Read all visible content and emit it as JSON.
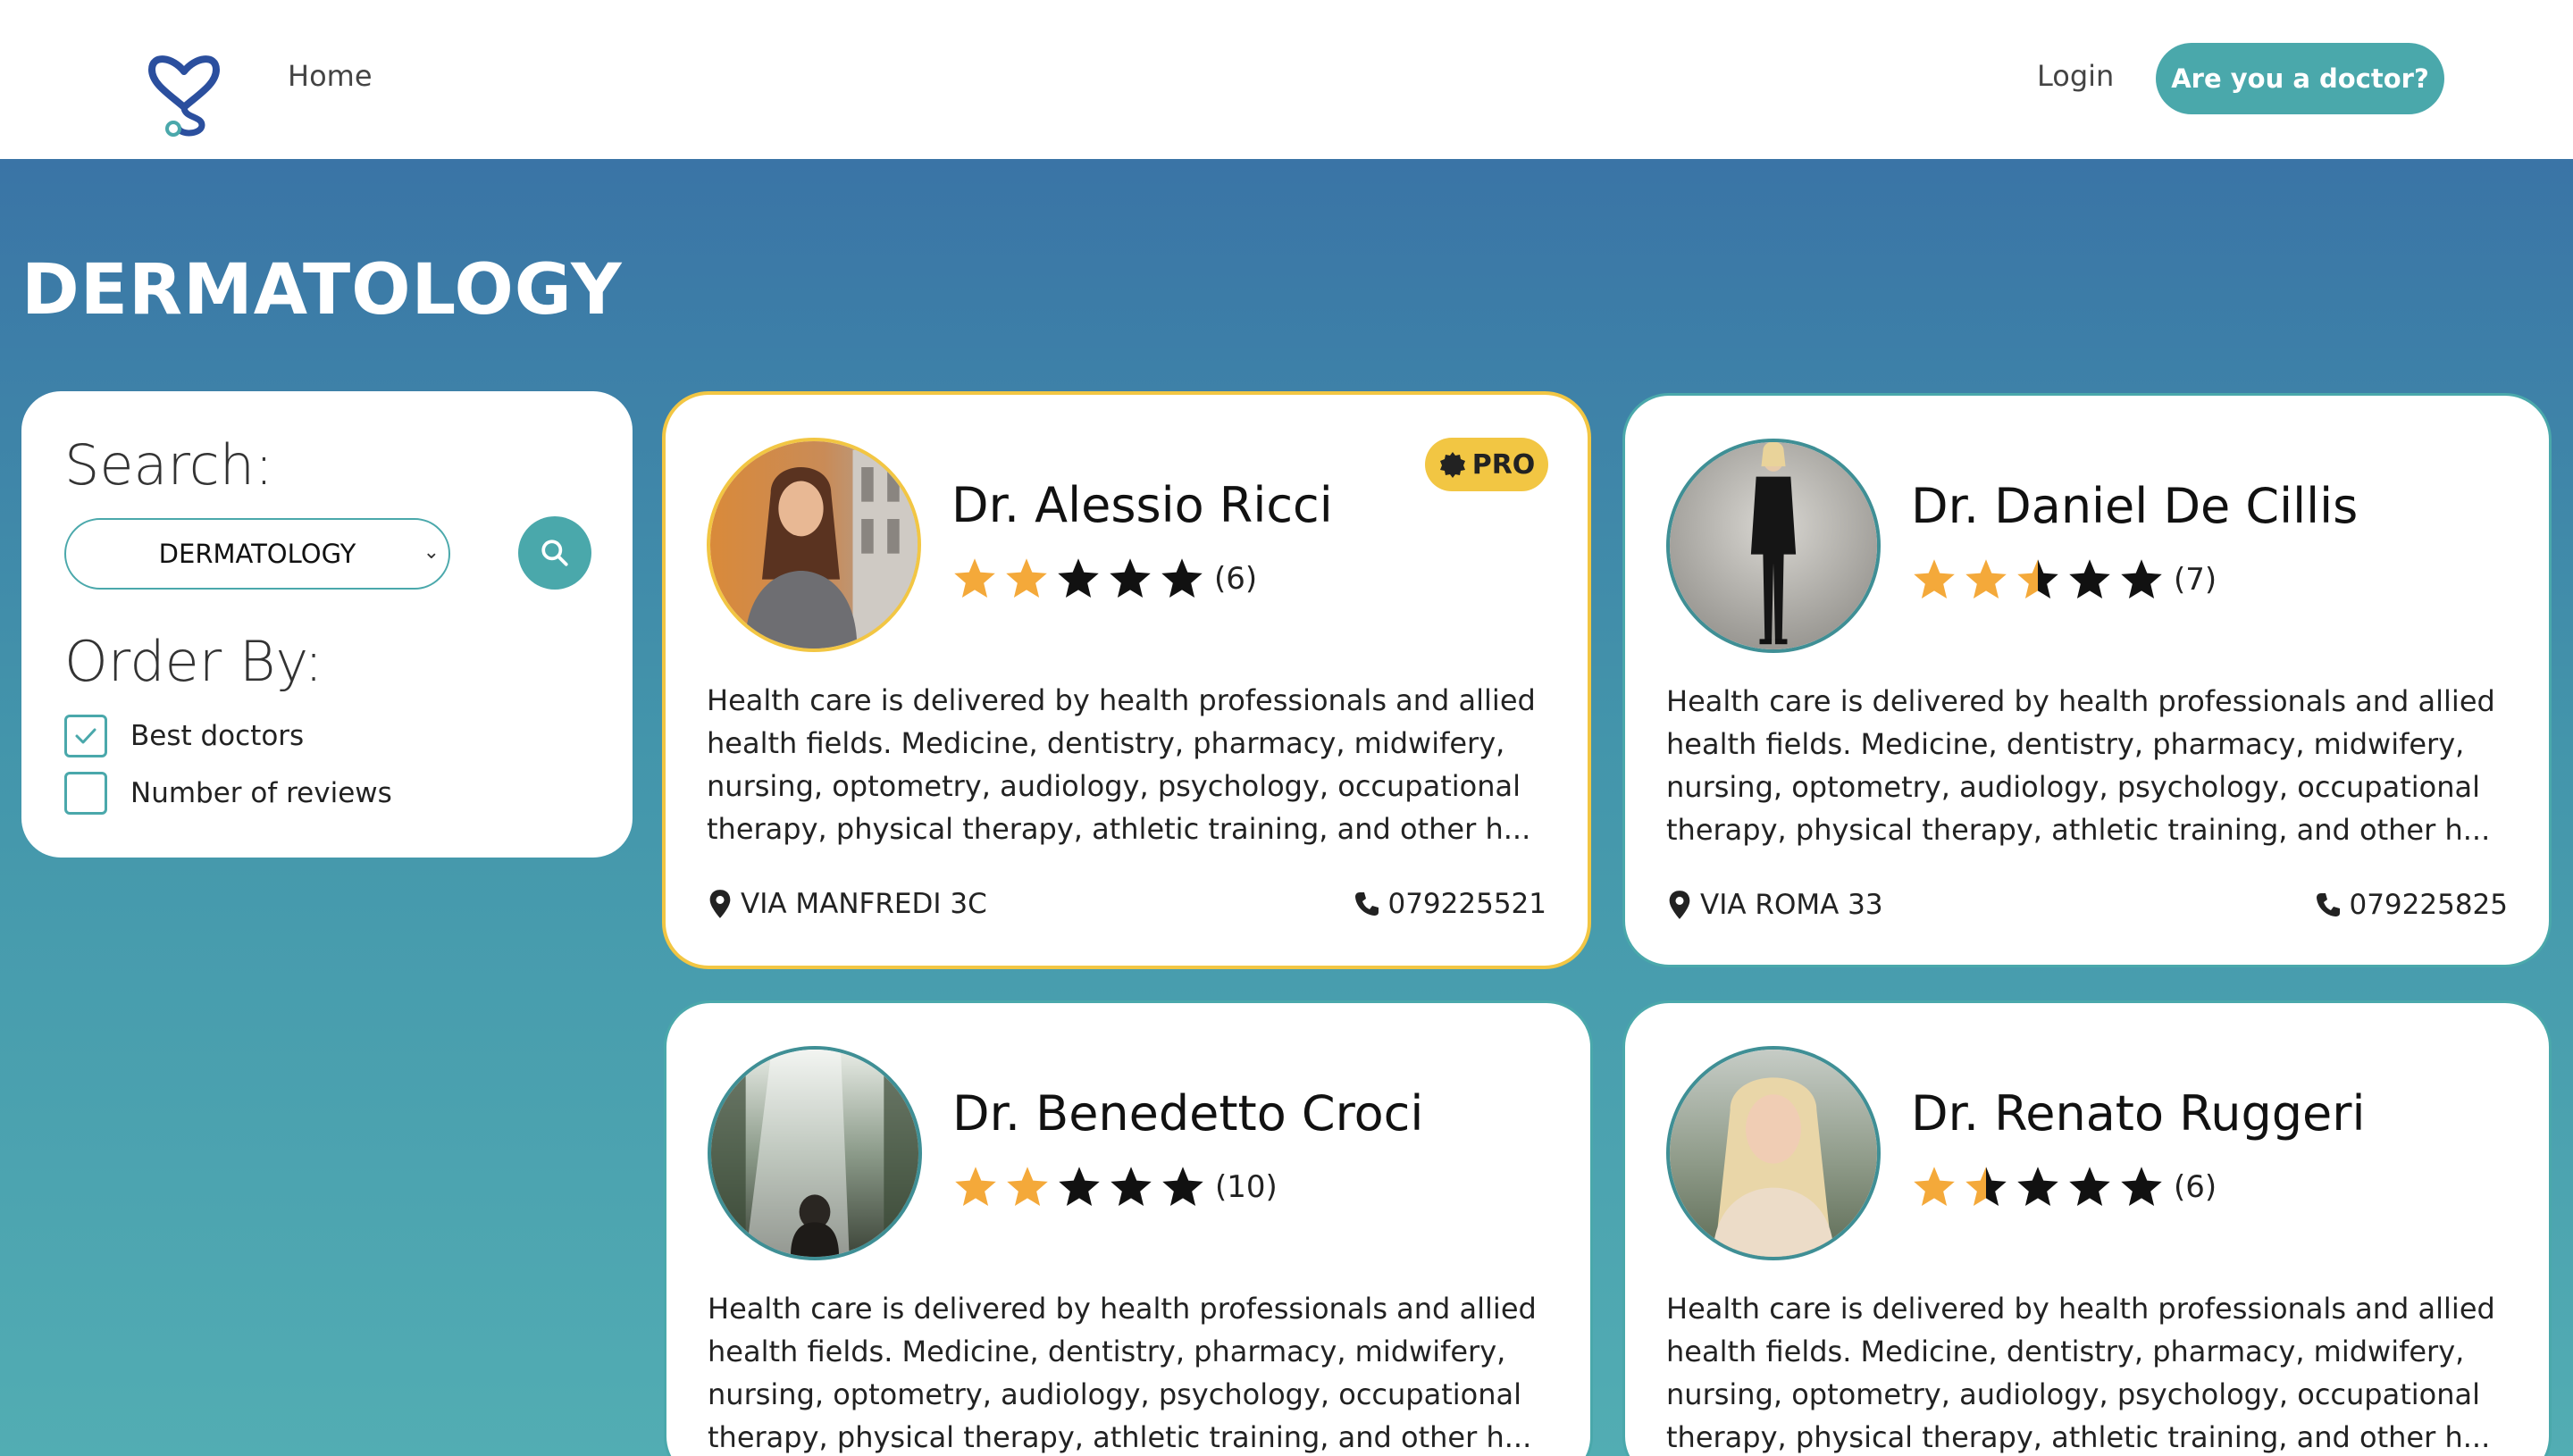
{
  "navbar": {
    "logo_icon": "stethoscope-heart-icon",
    "home_label": "Home",
    "login_label": "Login",
    "cta_label": "Are you a doctor?"
  },
  "page_title": "DERMATOLOGY",
  "filters": {
    "search_heading": "Search:",
    "specialty_selected": "DERMATOLOGY",
    "search_icon": "search-icon",
    "order_heading": "Order By:",
    "options": [
      {
        "label": "Best doctors",
        "checked": true
      },
      {
        "label": "Number of reviews",
        "checked": false
      }
    ]
  },
  "doctors": [
    {
      "name": "Dr. Alessio Ricci",
      "pro": true,
      "pro_label": "PRO",
      "rating": 2,
      "reviews": "(6)",
      "description": "Health care is delivered by health professionals and allied health fields. Medicine, dentistry, pharmacy, midwifery, nursing, optometry, audiology, psychology, occupational therapy, physical therapy, athletic training, and other h...",
      "address": "VIA MANFREDI 3C",
      "phone": "079225521"
    },
    {
      "name": "Dr. Daniel De Cillis",
      "pro": false,
      "rating": 2.5,
      "reviews": "(7)",
      "description": "Health care is delivered by health professionals and allied health fields. Medicine, dentistry, pharmacy, midwifery, nursing, optometry, audiology, psychology, occupational therapy, physical therapy, athletic training, and other h...",
      "address": "VIA ROMA 33",
      "phone": "079225825"
    },
    {
      "name": "Dr. Benedetto Croci",
      "pro": false,
      "rating": 2,
      "reviews": "(10)",
      "description": "Health care is delivered by health professionals and allied health fields. Medicine, dentistry, pharmacy, midwifery, nursing, optometry, audiology, psychology, occupational therapy, physical therapy, athletic training, and other h...",
      "address": "",
      "phone": ""
    },
    {
      "name": "Dr. Renato Ruggeri",
      "pro": false,
      "rating": 1.5,
      "reviews": "(6)",
      "description": "Health care is delivered by health professionals and allied health fields. Medicine, dentistry, pharmacy, midwifery, nursing, optometry, audiology, psychology, occupational therapy, physical therapy, athletic training, and other h...",
      "address": "",
      "phone": ""
    }
  ],
  "colors": {
    "teal": "#4aa8ab",
    "gradient_top": "#3a74a6",
    "gradient_bottom": "#52adb3",
    "pro_gold": "#f2c643",
    "star_gold": "#f4a93a",
    "star_empty": "#111111"
  }
}
